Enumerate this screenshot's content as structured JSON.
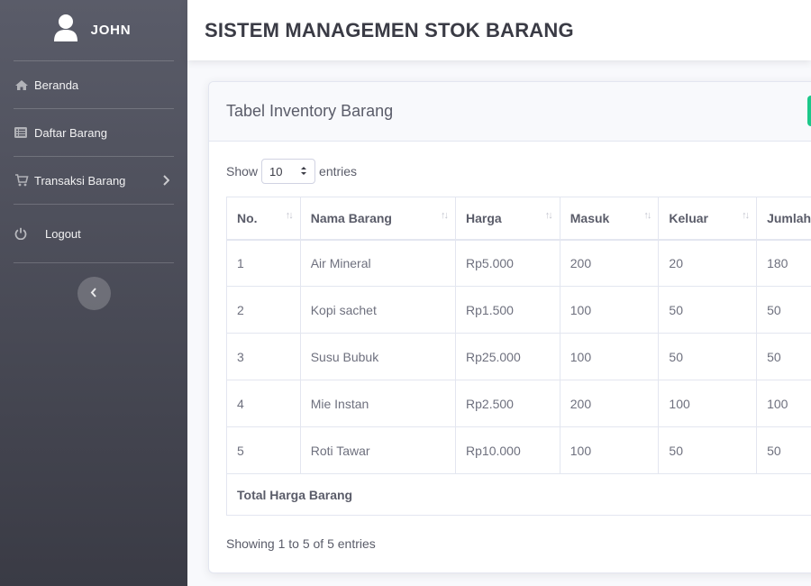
{
  "sidebar": {
    "user_name": "JOHN",
    "items": [
      {
        "label": "Beranda",
        "icon": "home-icon"
      },
      {
        "label": "Daftar Barang",
        "icon": "list-icon"
      },
      {
        "label": "Transaksi Barang",
        "icon": "cart-icon"
      },
      {
        "label": "Logout",
        "icon": "power-icon"
      }
    ]
  },
  "header": {
    "title": "SISTEM MANAGEMEN STOK BARANG"
  },
  "card": {
    "title": "Tabel Inventory Barang",
    "length": {
      "show": "Show",
      "value": "10",
      "entries": "entries"
    },
    "columns": [
      "No.",
      "Nama Barang",
      "Harga",
      "Masuk",
      "Keluar",
      "Jumlah"
    ],
    "rows": [
      [
        "1",
        "Air Mineral",
        "Rp5.000",
        "200",
        "20",
        "180"
      ],
      [
        "2",
        "Kopi sachet",
        "Rp1.500",
        "100",
        "50",
        "50"
      ],
      [
        "3",
        "Susu Bubuk",
        "Rp25.000",
        "100",
        "50",
        "50"
      ],
      [
        "4",
        "Mie Instan",
        "Rp2.500",
        "200",
        "100",
        "100"
      ],
      [
        "5",
        "Roti Tawar",
        "Rp10.000",
        "100",
        "50",
        "50"
      ]
    ],
    "footer_label": "Total Harga Barang",
    "info": "Showing 1 to 5 of 5 entries"
  },
  "colors": {
    "sidebar_top": "#5a5c69",
    "sidebar_bottom": "#3a3b45",
    "success": "#1cc88a"
  }
}
